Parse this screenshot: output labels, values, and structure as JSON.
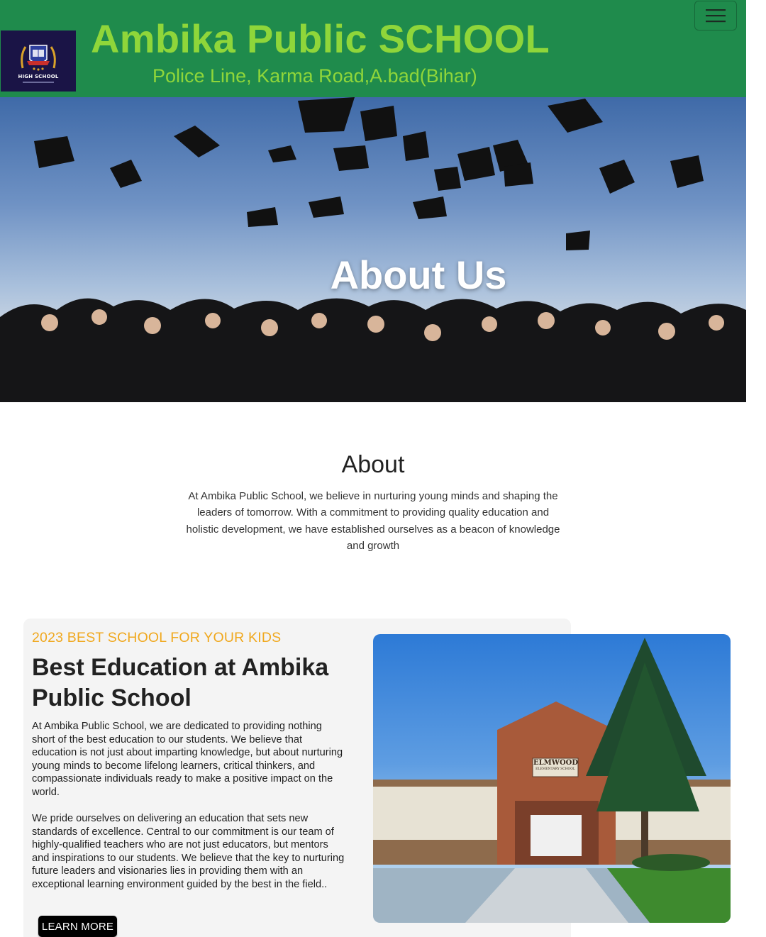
{
  "header": {
    "logo_text": "HIGH SCHOOL",
    "title": "Ambika Public SCHOOL",
    "address": "Police Line, Karma Road,A.bad(Bihar)",
    "menu_icon": "hamburger-icon",
    "background_color": "#1f8b4c",
    "title_color": "#8fd63a"
  },
  "hero": {
    "title": "About Us",
    "image": "graduates-throwing-caps"
  },
  "about": {
    "heading": "About",
    "text": "At Ambika Public School, we believe in nurturing young minds and shaping the leaders of tomorrow. With a commitment to providing quality education and holistic development, we have established ourselves as a beacon of knowledge and growth"
  },
  "feature": {
    "eyebrow": "2023 BEST SCHOOL FOR YOUR KIDS",
    "title": "Best Education at Ambika Public School",
    "paragraph1": "At Ambika Public School, we are dedicated to providing nothing short of the best education to our students. We believe that education is not just about imparting knowledge, but about nurturing young minds to become lifelong learners, critical thinkers, and compassionate individuals ready to make a positive impact on the world.",
    "paragraph2": "We pride ourselves on delivering an education that sets new standards of excellence. Central to our commitment is our team of highly-qualified teachers who are not just educators, but mentors and inspirations to our students. We believe that the key to nurturing future leaders and visionaries lies in providing them with an exceptional learning environment guided by the best in the field..",
    "button_label": "LEARN MORE",
    "image": "school-building",
    "building_sign": "ELMWOOD",
    "building_sign_sub": "ELEMENTARY SCHOOL",
    "eyebrow_color": "#f0a81e"
  }
}
